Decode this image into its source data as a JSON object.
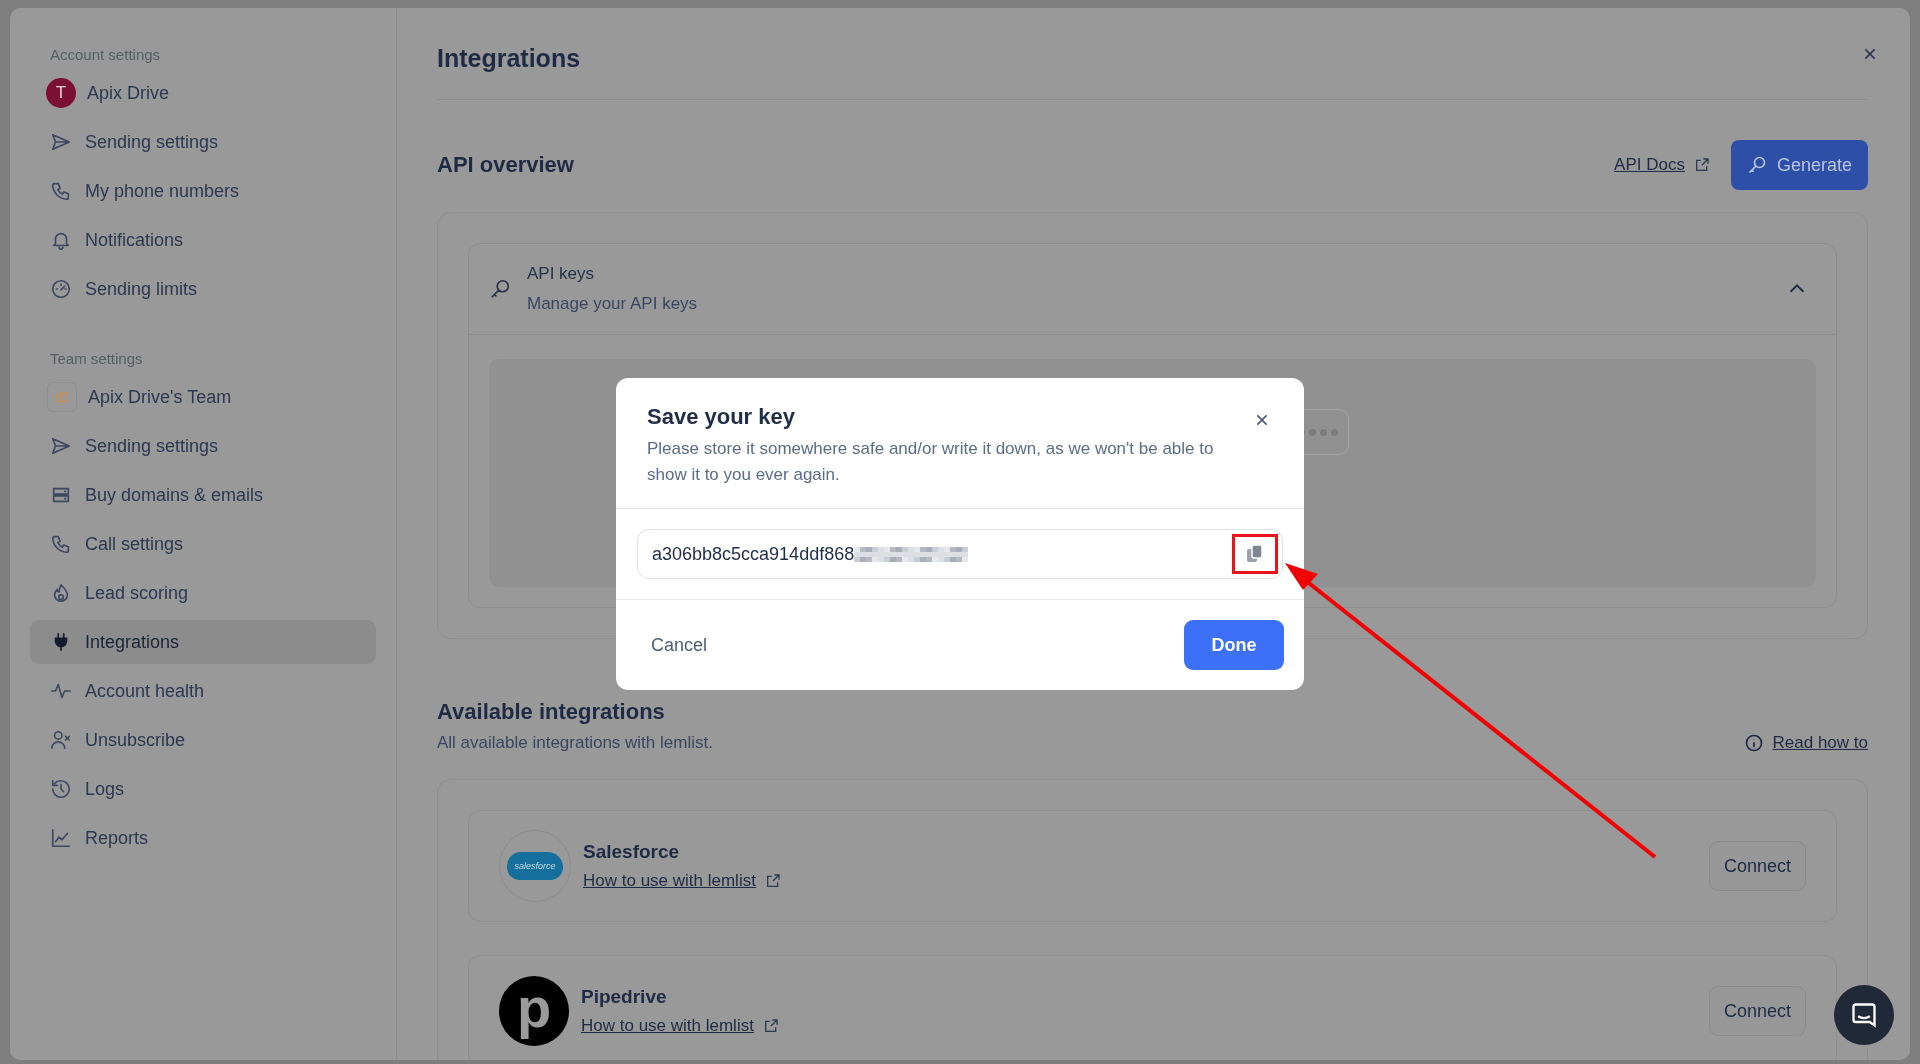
{
  "sidebar": {
    "sections": [
      {
        "heading": "Account settings",
        "items": [
          {
            "label": "Apix Drive",
            "kind": "avatar",
            "avatar_letter": "T",
            "selected": false
          },
          {
            "label": "Sending settings",
            "kind": "send",
            "selected": false
          },
          {
            "label": "My phone numbers",
            "kind": "phone",
            "selected": false
          },
          {
            "label": "Notifications",
            "kind": "bell",
            "selected": false
          },
          {
            "label": "Sending limits",
            "kind": "gauge",
            "selected": false
          }
        ]
      },
      {
        "heading": "Team settings",
        "items": [
          {
            "label": "Apix Drive's Team",
            "kind": "team",
            "selected": false
          },
          {
            "label": "Sending settings",
            "kind": "send",
            "selected": false
          },
          {
            "label": "Buy domains & emails",
            "kind": "server",
            "selected": false
          },
          {
            "label": "Call settings",
            "kind": "phone",
            "selected": false
          },
          {
            "label": "Lead scoring",
            "kind": "flame",
            "selected": false
          },
          {
            "label": "Integrations",
            "kind": "plug",
            "selected": true
          },
          {
            "label": "Account health",
            "kind": "activity",
            "selected": false
          },
          {
            "label": "Unsubscribe",
            "kind": "userx",
            "selected": false
          },
          {
            "label": "Logs",
            "kind": "history",
            "selected": false
          },
          {
            "label": "Reports",
            "kind": "chart",
            "selected": false
          }
        ]
      }
    ]
  },
  "main": {
    "title": "Integrations",
    "api_overview": {
      "title": "API overview",
      "docs_link": "API Docs",
      "generate_button": "Generate",
      "api_keys": {
        "title": "API keys",
        "subtitle": "Manage your API keys",
        "expanded": true
      }
    },
    "available_integrations": {
      "title": "Available integrations",
      "subtitle": "All available integrations with lemlist.",
      "read_how_to": "Read how to",
      "items": [
        {
          "name": "Salesforce",
          "kind": "cloud",
          "logo_text": "salesforce",
          "link": "How to use with lemlist",
          "button": "Connect"
        },
        {
          "name": "Pipedrive",
          "kind": "letter",
          "logo_text": "p",
          "link": "How to use with lemlist",
          "button": "Connect"
        }
      ]
    }
  },
  "modal": {
    "title": "Save your key",
    "message": "Please store it somewhere safe and/or write it down, as we won't be able to show it to you ever again.",
    "key_value": "a306bb8c5cca914ddf868",
    "key_pixelated": true,
    "cancel_button": "Cancel",
    "done_button": "Done"
  },
  "annotation": {
    "highlight_copy_button": true,
    "arrow": true
  }
}
